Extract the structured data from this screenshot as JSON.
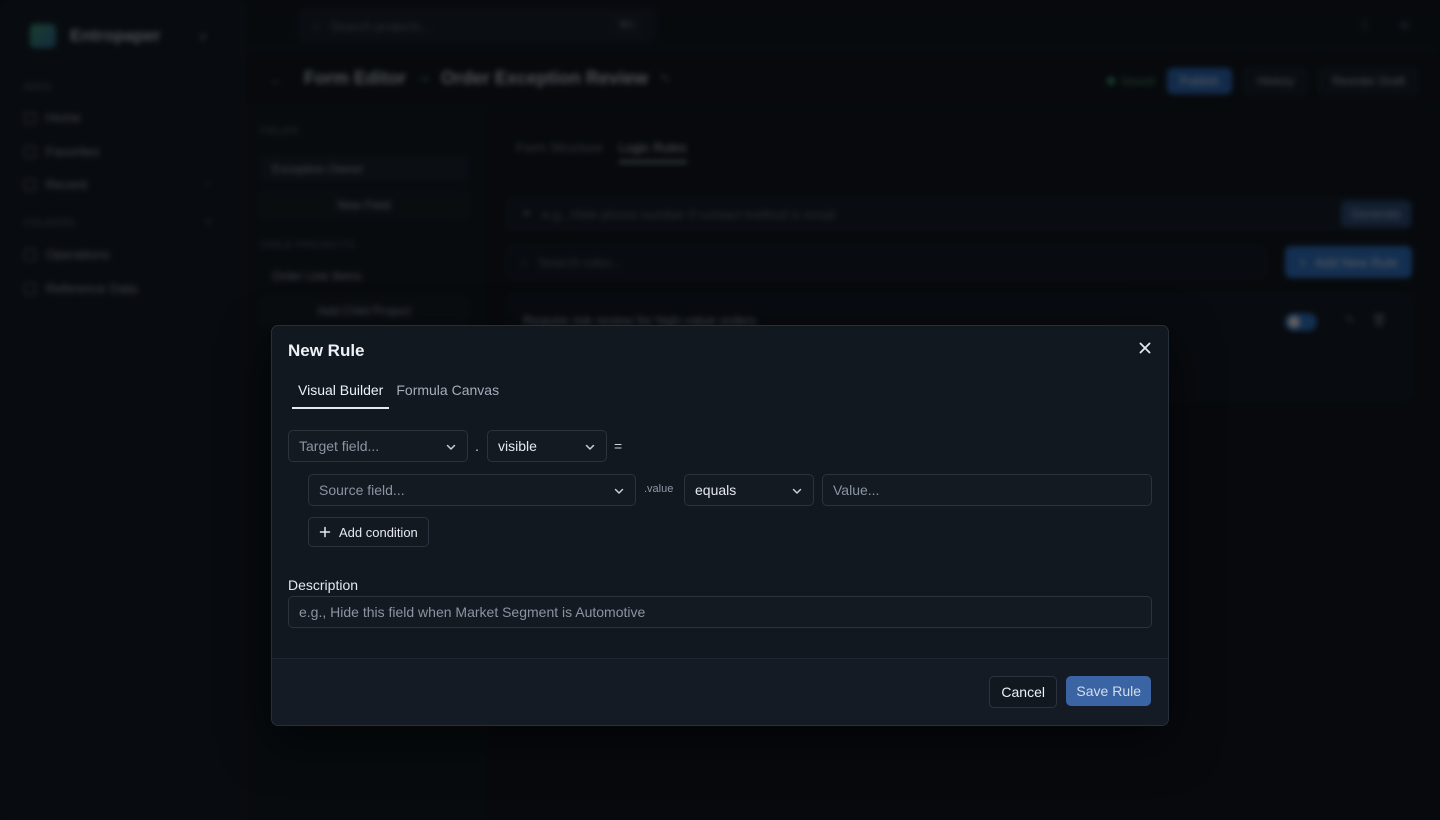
{
  "background": {
    "brand": "Entropaper",
    "sidebar": {
      "section_main": "MAIN",
      "items": [
        {
          "label": "Home"
        },
        {
          "label": "Favorites"
        },
        {
          "label": "Recent"
        }
      ],
      "section_folders": "FOLDERS",
      "folders": [
        {
          "label": "Operations"
        },
        {
          "label": "Reference Data"
        }
      ]
    },
    "topbar": {
      "search_placeholder": "Search projects...",
      "shortcut": "⌘K"
    },
    "header": {
      "section": "Form Editor",
      "title": "Order Exception Review",
      "status": "Saved",
      "publish": "Publish",
      "history": "History",
      "reorder": "Reorder Draft"
    },
    "fields_panel": {
      "fields_label": "FIELDS",
      "field": "Exception Owner",
      "new_field": "New Field",
      "child_label": "CHILD PROJECTS",
      "child": "Order Line Items",
      "add_child": "Add Child Project"
    },
    "main": {
      "tabs": [
        "Form Structure",
        "Logic Rules"
      ],
      "ai_placeholder": "e.g., Hide phone number if contact method is email",
      "ai_button": "Generate",
      "search_placeholder": "Search rules...",
      "new_rule": "Add New Rule",
      "rule_title": "Require risk review for high-value orders"
    }
  },
  "modal": {
    "title": "New Rule",
    "tabs": [
      {
        "label": "Visual Builder",
        "active": true
      },
      {
        "label": "Formula Canvas",
        "active": false
      }
    ],
    "target_placeholder": "Target field...",
    "dot": ".",
    "property_value": "visible",
    "equals_sign": "=",
    "source_placeholder": "Source field...",
    "value_suffix": ".value",
    "operator_value": "equals",
    "value_placeholder": "Value...",
    "add_condition": "Add condition",
    "description_label": "Description",
    "description_placeholder": "e.g., Hide this field when Market Segment is Automotive",
    "cancel": "Cancel",
    "save": "Save Rule"
  },
  "colors": {
    "accent": "#2f79d3",
    "save_button": "#3a64a4",
    "modal_bg": "#121820"
  }
}
